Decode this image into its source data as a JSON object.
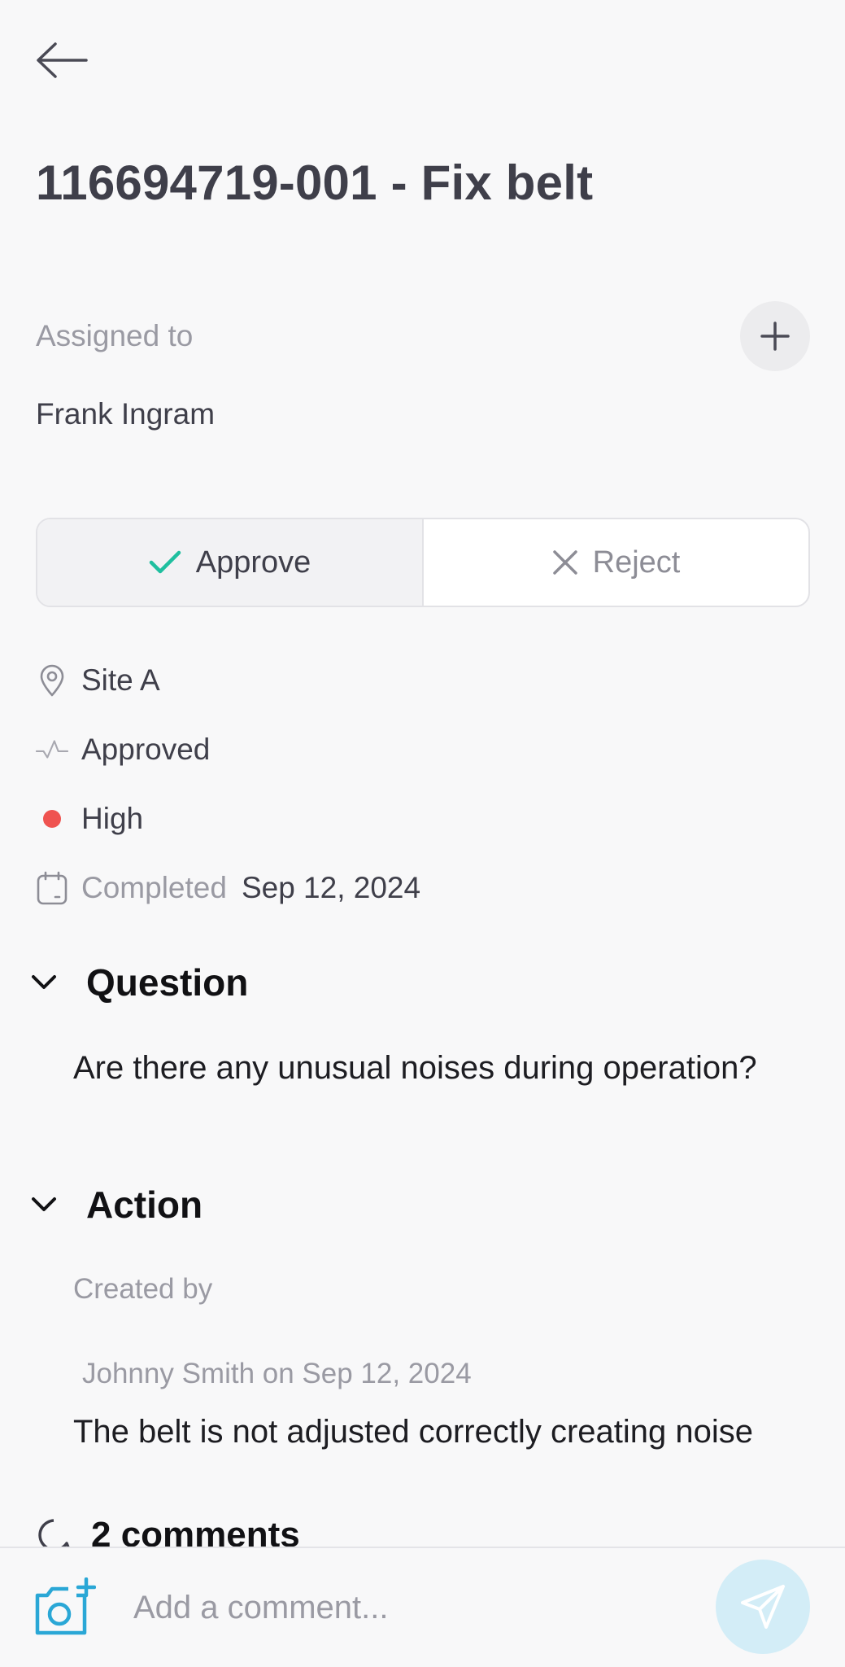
{
  "header": {
    "back_icon": "arrow-left-icon",
    "title": "116694719-001 - Fix belt"
  },
  "assignment": {
    "label": "Assigned to",
    "assignee": "Frank Ingram",
    "add_icon": "plus-icon"
  },
  "decision": {
    "approve_label": "Approve",
    "reject_label": "Reject",
    "selected": "Approve",
    "approve_color": "#1fbf9f"
  },
  "details": {
    "location": "Site A",
    "status": "Approved",
    "priority": "High",
    "priority_color": "#ef5350",
    "completed_label": "Completed",
    "completed_date": "Sep 12, 2024"
  },
  "question_section": {
    "title": "Question",
    "text": "Are there any unusual noises during operation?"
  },
  "action_section": {
    "title": "Action",
    "created_by_label": "Created by",
    "creator_line": "Johnny Smith on Sep 12, 2024",
    "text": "The belt is not adjusted correctly creating noise"
  },
  "comments": {
    "count_label": "2 comments",
    "input_placeholder": "Add a comment...",
    "camera_icon": "add-photo-icon",
    "send_icon": "send-icon",
    "accent_color": "#2aa7d6"
  }
}
